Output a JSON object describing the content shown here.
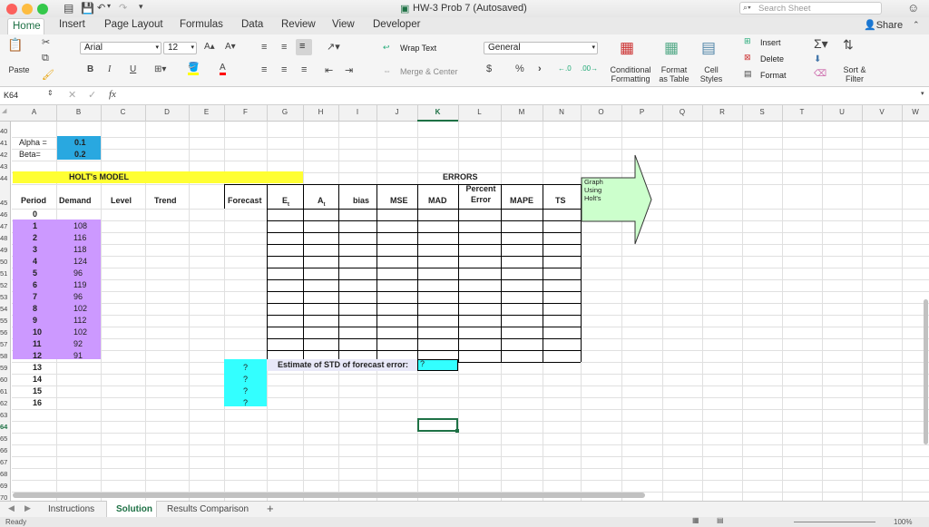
{
  "window": {
    "title": "HW-3 Prob 7 (Autosaved)",
    "search_placeholder": "Search Sheet",
    "share": "Share"
  },
  "tabs": [
    "Home",
    "Insert",
    "Page Layout",
    "Formulas",
    "Data",
    "Review",
    "View",
    "Developer"
  ],
  "ribbon": {
    "font": "Arial",
    "font_size": "12",
    "wrap_text": "Wrap Text",
    "merge_center": "Merge & Center",
    "number_format": "General",
    "paste": "Paste",
    "insert": "Insert",
    "delete": "Delete",
    "format": "Format",
    "sort_filter": "Sort &\nFilter",
    "conditional_formatting": "Conditional\nFormatting",
    "format_as_table": "Format\nas Table",
    "cell_styles": "Cell\nStyles",
    "bold": "B",
    "italic": "I",
    "underline": "U",
    "percent": "%",
    "comma": "›",
    "dollar": "$"
  },
  "formula_bar": {
    "name_box": "K64",
    "fx": "fx",
    "value": ""
  },
  "columns": [
    "A",
    "B",
    "C",
    "D",
    "E",
    "F",
    "G",
    "H",
    "I",
    "J",
    "K",
    "L",
    "M",
    "N",
    "O",
    "P",
    "Q",
    "R",
    "S",
    "T",
    "U",
    "V",
    "W"
  ],
  "rows": [
    "40",
    "41",
    "42",
    "43",
    "44",
    "45",
    "46",
    "47",
    "48",
    "49",
    "50",
    "51",
    "52",
    "53",
    "54",
    "55",
    "56",
    "57",
    "58",
    "59",
    "60",
    "61",
    "62",
    "63",
    "64",
    "65",
    "66",
    "67",
    "68",
    "69",
    "70"
  ],
  "sheet": {
    "alpha_label": "Alpha =",
    "alpha_value": "0.1",
    "beta_label": "Beta=",
    "beta_value": "0.2",
    "model_title": "HOLT's MODEL",
    "errors_title": "ERRORS",
    "headers": {
      "period": "Period",
      "demand": "Demand",
      "level": "Level",
      "trend": "Trend",
      "forecast": "Forecast",
      "et": "E",
      "et_sub": "t",
      "at": "A",
      "at_sub": "t",
      "bias": "bias",
      "mse": "MSE",
      "mad": "MAD",
      "percent_error": "Percent\nError",
      "mape": "MAPE",
      "ts": "TS"
    },
    "periods": [
      "0",
      "1",
      "2",
      "3",
      "4",
      "5",
      "6",
      "7",
      "8",
      "9",
      "10",
      "11",
      "12",
      "13",
      "14",
      "15",
      "16"
    ],
    "demand": [
      "",
      "108",
      "116",
      "118",
      "124",
      "96",
      "119",
      "96",
      "102",
      "112",
      "102",
      "92",
      "91"
    ],
    "forecast_unknown": [
      "?",
      "?",
      "?",
      "?"
    ],
    "std_label": "Estimate of STD of forecast error:",
    "std_value": "?",
    "graph_label": "Graph\nUsing Holt's"
  },
  "sheet_tabs": [
    "Instructions",
    "Solution",
    "Results Comparison"
  ],
  "active_sheet": "Solution",
  "status": {
    "ready": "Ready",
    "zoom": "100%"
  },
  "colors": {
    "accent": "#1e7145",
    "cyan": "#33ccff",
    "purple": "#cc99ff",
    "yellow": "#ffff33",
    "light_green": "#ccffcc"
  }
}
